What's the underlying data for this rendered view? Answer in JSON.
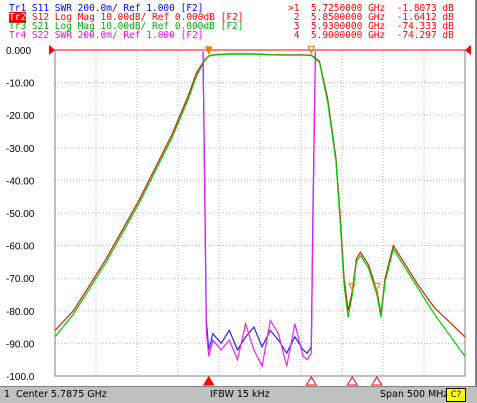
{
  "traces": [
    {
      "id": "Tr1",
      "param": "S11",
      "format": "SWR",
      "scale": "200.0m/",
      "ref": "Ref 1.000",
      "tag": "[F2]",
      "color": "#0000ff",
      "active": false
    },
    {
      "id": "Tr2",
      "param": "S12",
      "format": "Log Mag",
      "scale": "10.00dB/",
      "ref": "Ref 0.000dB",
      "tag": "[F2]",
      "color": "#ff0000",
      "active": true
    },
    {
      "id": "Tr3",
      "param": "S21",
      "format": "Log Mag",
      "scale": "10.00dB/",
      "ref": "Ref 0.000dB",
      "tag": "[F2]",
      "color": "#00cc00",
      "active": false
    },
    {
      "id": "Tr4",
      "param": "S22",
      "format": "SWR",
      "scale": "200.0m/",
      "ref": "Ref 1.000",
      "tag": "[F2]",
      "color": "#ff00ff",
      "active": false
    }
  ],
  "markers": [
    {
      "n": ">1",
      "freq": "5.7250000 GHz",
      "value": "-1.8073 dB"
    },
    {
      "n": "2",
      "freq": "5.8500000 GHz",
      "value": "-1.6412 dB"
    },
    {
      "n": "3",
      "freq": "5.9300000 GHz",
      "value": "-74.333 dB"
    },
    {
      "n": "4",
      "freq": "5.9000000 GHz",
      "value": "-74.297 dB"
    }
  ],
  "status": {
    "channel": "1",
    "center": "Center 5.7875 GHz",
    "ifbw": "IFBW 15 kHz",
    "span": "Span 500 MHz",
    "cal": "C?"
  },
  "chart_data": {
    "type": "line",
    "title": "",
    "xlabel": "",
    "ylabel": "",
    "xlim": [
      5.5375,
      6.0375
    ],
    "ylim": [
      -100,
      0
    ],
    "yticks": [
      0,
      -10,
      -20,
      -30,
      -40,
      -50,
      -60,
      -70,
      -80,
      -90,
      -100
    ],
    "ytick_labels": [
      "0.000",
      "-10.00",
      "-20.00",
      "-30.00",
      "-40.00",
      "-50.00",
      "-60.00",
      "-70.00",
      "-80.00",
      "-90.00",
      "-100.0"
    ],
    "grid": true,
    "series": [
      {
        "name": "Tr2 S12",
        "color": "#cc2200",
        "x": [
          5.5375,
          5.56,
          5.58,
          5.6,
          5.62,
          5.64,
          5.66,
          5.68,
          5.7,
          5.71,
          5.72,
          5.725,
          5.73,
          5.75,
          5.78,
          5.8,
          5.82,
          5.84,
          5.85,
          5.86,
          5.87,
          5.88,
          5.885,
          5.89,
          5.895,
          5.9,
          5.905,
          5.91,
          5.92,
          5.93,
          5.935,
          5.94,
          5.95,
          5.96,
          5.98,
          6.0,
          6.0375
        ],
        "y": [
          -86,
          -80,
          -72,
          -64,
          -55,
          -46,
          -36,
          -26,
          -14,
          -7,
          -3,
          -1.8,
          -1.5,
          -1.2,
          -1.2,
          -1.4,
          -1.5,
          -1.5,
          -1.6,
          -3.5,
          -15,
          -33,
          -50,
          -70,
          -80,
          -74,
          -64,
          -62,
          -66,
          -74,
          -81,
          -70,
          -60,
          -64,
          -72,
          -79,
          -88
        ]
      },
      {
        "name": "Tr3 S21",
        "color": "#00cc00",
        "x": [
          5.5375,
          5.56,
          5.58,
          5.6,
          5.62,
          5.64,
          5.66,
          5.68,
          5.7,
          5.71,
          5.72,
          5.725,
          5.73,
          5.75,
          5.78,
          5.8,
          5.82,
          5.84,
          5.85,
          5.86,
          5.87,
          5.88,
          5.885,
          5.89,
          5.895,
          5.9,
          5.905,
          5.91,
          5.92,
          5.93,
          5.935,
          5.94,
          5.95,
          5.96,
          5.98,
          6.0,
          6.0375
        ],
        "y": [
          -88,
          -81,
          -73,
          -65,
          -56,
          -47,
          -37,
          -27,
          -15,
          -8,
          -3.2,
          -1.9,
          -1.6,
          -1.3,
          -1.3,
          -1.5,
          -1.6,
          -1.6,
          -1.7,
          -3.8,
          -16,
          -34,
          -52,
          -72,
          -82,
          -75,
          -65,
          -63,
          -67,
          -75,
          -82,
          -71,
          -61,
          -65,
          -73,
          -81,
          -94
        ]
      },
      {
        "name": "Tr1 S11",
        "color": "#2222ee",
        "x": [
          5.718,
          5.72,
          5.722,
          5.725,
          5.73,
          5.74,
          5.75,
          5.76,
          5.77,
          5.78,
          5.79,
          5.8,
          5.81,
          5.82,
          5.83,
          5.84,
          5.845,
          5.85,
          5.852,
          5.855
        ],
        "y": [
          -0.5,
          -40,
          -83,
          -92,
          -87,
          -90,
          -86,
          -92,
          -88,
          -85,
          -91,
          -86,
          -89,
          -93,
          -88,
          -92,
          -93,
          -91,
          -50,
          -0.5
        ]
      },
      {
        "name": "Tr4 S22",
        "color": "#ee22ee",
        "x": [
          5.718,
          5.72,
          5.722,
          5.725,
          5.73,
          5.74,
          5.75,
          5.76,
          5.77,
          5.78,
          5.79,
          5.8,
          5.81,
          5.82,
          5.83,
          5.84,
          5.845,
          5.85,
          5.852,
          5.855
        ],
        "y": [
          -0.5,
          -45,
          -86,
          -94,
          -89,
          -92,
          -89,
          -95,
          -84,
          -92,
          -97,
          -83,
          -87,
          -97,
          -84,
          -94,
          -95,
          -93,
          -55,
          -0.5
        ]
      }
    ]
  }
}
